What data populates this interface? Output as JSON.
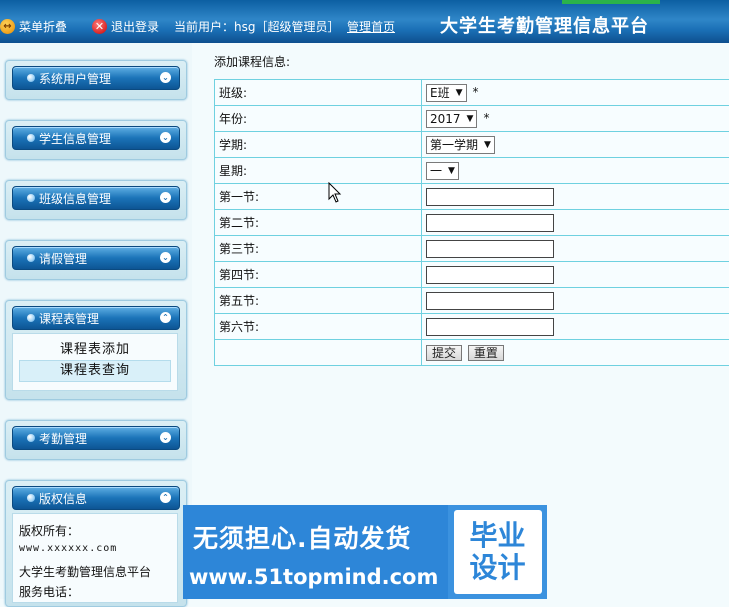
{
  "header": {
    "menu_toggle": "菜单折叠",
    "logout": "退出登录",
    "current_user": "当前用户：hsg［超级管理员］",
    "home_link": "管理首页",
    "platform_title": "大学生考勤管理信息平台"
  },
  "sidebar": {
    "panels": [
      {
        "label": "系统用户管理"
      },
      {
        "label": "学生信息管理"
      },
      {
        "label": "班级信息管理"
      },
      {
        "label": "请假管理"
      },
      {
        "label": "课程表管理",
        "items": [
          "课程表添加",
          "课程表查询"
        ]
      },
      {
        "label": "考勤管理"
      },
      {
        "label": "版权信息",
        "lines": [
          "版权所有：",
          "www.xxxxxx.com",
          "大学生考勤管理信息平台",
          "服务电话："
        ]
      }
    ]
  },
  "main": {
    "page_title": "添加课程信息:",
    "rows": {
      "class": {
        "label": "班级:",
        "value": "E班"
      },
      "year": {
        "label": "年份:",
        "value": "2017"
      },
      "semester": {
        "label": "学期:",
        "value": "第一学期"
      },
      "weekday": {
        "label": "星期:",
        "value": "一"
      },
      "p1": {
        "label": "第一节:"
      },
      "p2": {
        "label": "第二节:"
      },
      "p3": {
        "label": "第三节:"
      },
      "p4": {
        "label": "第四节:"
      },
      "p5": {
        "label": "第五节:"
      },
      "p6": {
        "label": "第六节:"
      }
    },
    "required_mark": "*",
    "submit": "提交",
    "reset": "重置"
  },
  "watermark": {
    "slogan": "无须担心.自动发货",
    "url": "www.51topmind.com",
    "badge_line1": "毕业",
    "badge_line2": "设计"
  },
  "colors": {
    "header_blue": "#1a6fb5",
    "table_border": "#6fd1e0",
    "watermark_blue": "#2d86d8"
  }
}
